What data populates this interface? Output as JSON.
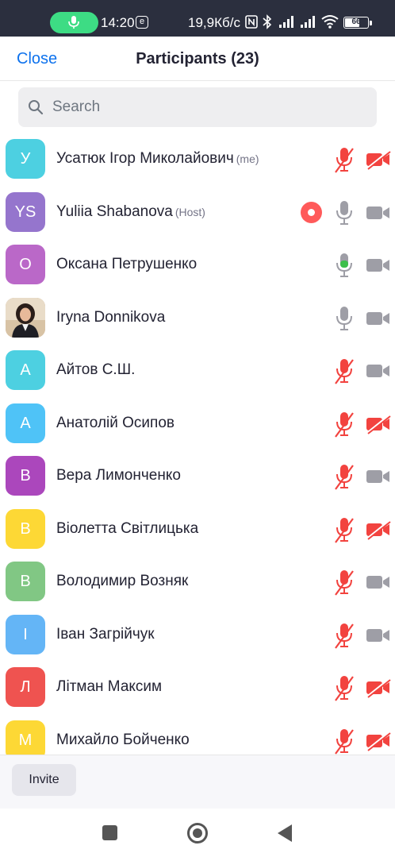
{
  "status_bar": {
    "time": "14:20",
    "e_badge": "e",
    "speed": "19,9Кб/с",
    "battery": "66",
    "battery_level": 0.66
  },
  "header": {
    "close_label": "Close",
    "title": "Participants (23)"
  },
  "search": {
    "placeholder": "Search"
  },
  "participants": [
    {
      "initial": "У",
      "name": "Усатюк Ігор Миколайович",
      "tag": "(me)",
      "color": "#4dd0e1",
      "mic": "muted",
      "video": "off"
    },
    {
      "initial": "YS",
      "name": "Yuliia Shabanova",
      "tag": "(Host)",
      "color": "#9575cd",
      "recording": true,
      "mic": "on",
      "video": "on"
    },
    {
      "initial": "О",
      "name": "Оксана Петрушенко",
      "tag": "",
      "color": "#ba68c8",
      "mic": "speaking",
      "video": "on"
    },
    {
      "initial": "",
      "name": "Iryna Donnikova",
      "tag": "",
      "color": "#c9a98a",
      "photo": true,
      "mic": "on",
      "video": "on"
    },
    {
      "initial": "А",
      "name": "Айтов  С.Ш.",
      "tag": "",
      "color": "#4dd0e1",
      "mic": "muted",
      "video": "on"
    },
    {
      "initial": "А",
      "name": "Анатолій Осипов",
      "tag": "",
      "color": "#4fc3f7",
      "mic": "muted",
      "video": "off"
    },
    {
      "initial": "В",
      "name": "Вера Лимонченко",
      "tag": "",
      "color": "#ab47bc",
      "mic": "muted",
      "video": "on"
    },
    {
      "initial": "В",
      "name": "Віолетта Світлицька",
      "tag": "",
      "color": "#fdd835",
      "mic": "muted",
      "video": "off"
    },
    {
      "initial": "В",
      "name": "Володимир Возняк",
      "tag": "",
      "color": "#81c784",
      "mic": "muted",
      "video": "on"
    },
    {
      "initial": "І",
      "name": "Іван Загрійчук",
      "tag": "",
      "color": "#64b5f6",
      "mic": "muted",
      "video": "on"
    },
    {
      "initial": "Л",
      "name": "Літман Максим",
      "tag": "",
      "color": "#ef5350",
      "mic": "muted",
      "video": "off"
    },
    {
      "initial": "М",
      "name": "Михайло Бойченко",
      "tag": "",
      "color": "#fdd835",
      "mic": "muted",
      "video": "off"
    }
  ],
  "footer": {
    "invite_label": "Invite"
  },
  "colors": {
    "accent": "#0e72ed",
    "muted_red": "#f2433f",
    "icon_gray": "#9e9ea6",
    "speaking_green": "#3dbf4a"
  }
}
